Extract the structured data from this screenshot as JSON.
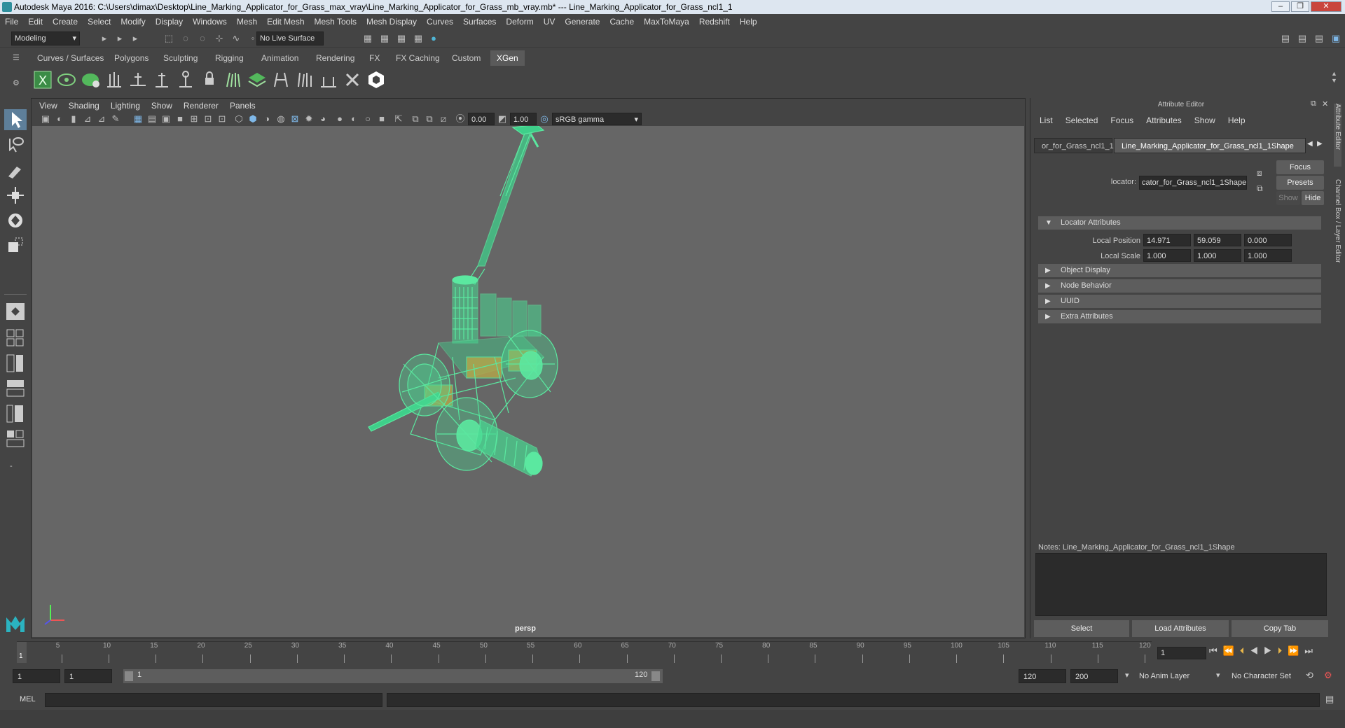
{
  "window": {
    "title": "Autodesk Maya 2016: C:\\Users\\dimax\\Desktop\\Line_Marking_Applicator_for_Grass_max_vray\\Line_Marking_Applicator_for_Grass_mb_vray.mb*   ---   Line_Marking_Applicator_for_Grass_ncl1_1",
    "min": "–",
    "max": "❐",
    "close": "✕"
  },
  "menubar": [
    "File",
    "Edit",
    "Create",
    "Select",
    "Modify",
    "Display",
    "Windows",
    "Mesh",
    "Edit Mesh",
    "Mesh Tools",
    "Mesh Display",
    "Curves",
    "Surfaces",
    "Deform",
    "UV",
    "Generate",
    "Cache",
    "MaxToMaya",
    "Redshift",
    "Help"
  ],
  "toolbar": {
    "mode": "Modeling",
    "live_surface": "No Live Surface"
  },
  "shelf_tabs": [
    "Curves / Surfaces",
    "Polygons",
    "Sculpting",
    "Rigging",
    "Animation",
    "Rendering",
    "FX",
    "FX Caching",
    "Custom",
    "XGen"
  ],
  "shelf_active": "XGen",
  "viewport": {
    "menu": [
      "View",
      "Shading",
      "Lighting",
      "Show",
      "Renderer",
      "Panels"
    ],
    "exposure": "0.00",
    "gamma": "1.00",
    "color_space": "sRGB gamma",
    "camera_label": "persp",
    "wire_color": "#5be8a0"
  },
  "attribute_editor": {
    "title": "Attribute Editor",
    "menu": [
      "List",
      "Selected",
      "Focus",
      "Attributes",
      "Show",
      "Help"
    ],
    "tabs": [
      "or_for_Grass_ncl1_1",
      "Line_Marking_Applicator_for_Grass_ncl1_1Shape"
    ],
    "locator_label": "locator:",
    "locator_value": "cator_for_Grass_ncl1_1Shape",
    "focus": "Focus",
    "presets": "Presets",
    "show": "Show",
    "hide": "Hide",
    "sections": {
      "locator_attributes": "Locator Attributes",
      "object_display": "Object Display",
      "node_behavior": "Node Behavior",
      "uuid": "UUID",
      "extra_attributes": "Extra Attributes"
    },
    "local_position_label": "Local Position",
    "local_position": [
      "14.971",
      "59.059",
      "0.000"
    ],
    "local_scale_label": "Local Scale",
    "local_scale": [
      "1.000",
      "1.000",
      "1.000"
    ],
    "notes": "Notes:  Line_Marking_Applicator_for_Grass_ncl1_1Shape",
    "buttons": {
      "select": "Select",
      "load": "Load Attributes",
      "copy": "Copy Tab"
    },
    "side_tabs": [
      "Attribute Editor",
      "Channel Box / Layer Editor"
    ]
  },
  "timeline": {
    "ticks": [
      "5",
      "10",
      "15",
      "20",
      "25",
      "30",
      "35",
      "40",
      "45",
      "50",
      "55",
      "60",
      "65",
      "70",
      "75",
      "80",
      "85",
      "90",
      "95",
      "100",
      "105",
      "110",
      "115",
      "120"
    ],
    "start_tick": "1",
    "current_frame": "1"
  },
  "range": {
    "start": "1",
    "anim_start": "1",
    "slider_start": "1",
    "slider_end": "120",
    "end": "120",
    "anim_end": "200",
    "anim_layer": "No Anim Layer",
    "char_set": "No Character Set"
  },
  "command": {
    "lang": "MEL"
  }
}
